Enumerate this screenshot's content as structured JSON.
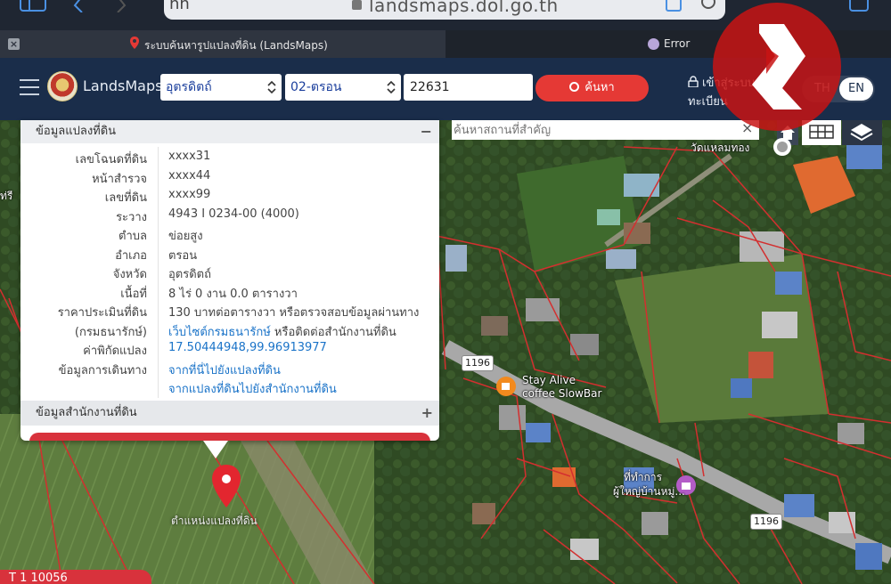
{
  "browser": {
    "url": "landsmaps.dol.go.th",
    "url_left": "ññ",
    "tabs": [
      {
        "title": "ระบบค้นหารูปแปลงที่ดิน (LandsMaps)"
      },
      {
        "title": "Error"
      }
    ]
  },
  "header": {
    "brand": "LandsMaps",
    "province": "อุตรดิตถ์",
    "district": "02-ตรอน",
    "parcel_number": "22631",
    "search_label": "ค้นหา",
    "login_line1": "เข้าสู่ระบบ/ลง",
    "login_line2": "ทะเบียน",
    "lang_th": "TH",
    "lang_en": "EN"
  },
  "map": {
    "search_placeholder": "ค้นหาสถานที่สำคัญ",
    "clear_label": "×",
    "labels": {
      "temple": "วัดแหลมทอง",
      "cafe_line1": "Stay Alive",
      "cafe_line2": "coffee SlowBar",
      "office_line1": "ที่ทำการ",
      "office_line2": "ผู้ใหญ่บ้านหมู่...",
      "road1": "1196",
      "road2": "1196",
      "left_edge": "ท่รี",
      "pin_label": "ตำแหน่งแปลงที่ดิน"
    }
  },
  "panel": {
    "title": "ข้อมูลแปลงที่ดิน",
    "collapse": "−",
    "rows": [
      {
        "label": "เลขโฉนดที่ดิน",
        "value": "xxxx31"
      },
      {
        "label": "หน้าสำรวจ",
        "value": "xxxx44"
      },
      {
        "label": "เลขที่ดิน",
        "value": "xxxx99"
      },
      {
        "label": "ระวาง",
        "value": "4943 I 0234-00 (4000)"
      },
      {
        "label": "ตำบล",
        "value": "ข่อยสูง"
      },
      {
        "label": "อำเภอ",
        "value": "ตรอน"
      },
      {
        "label": "จังหวัด",
        "value": "อุตรดิตถ์"
      },
      {
        "label": "เนื้อที่",
        "value": "8 ไร่ 0 งาน 0.0 ตารางวา"
      },
      {
        "label": "ราคาประเมินที่ดิน",
        "value": "130 บาทต่อตารางวา หรือตรวจสอบข้อมูลผ่านทาง"
      },
      {
        "label": "(กรมธนารักษ์)",
        "value_link": "เว็บไซต์กรมธนารักษ์",
        "value_rest": " หรือติดต่อสำนักงานที่ดิน"
      },
      {
        "label": "ค่าพิกัดแปลง",
        "value": "17.50444948,99.96913977"
      },
      {
        "label": "ข้อมูลการเดินทาง",
        "value": "จากที่นี่ไปยังแปลงที่ดิน"
      },
      {
        "label": "",
        "value": "จากแปลงที่ดินไปยังสำนักงานที่ดิน"
      }
    ],
    "office_title": "ข้อมูลสำนักงานที่ดิน",
    "expand": "+"
  },
  "colors": {
    "header_bg": "#1a2d4a",
    "accent_red": "#e53935",
    "link_blue": "#1a73c8",
    "parcel_line": "#d32f2f"
  },
  "bottom_badge": "T 1 10056"
}
